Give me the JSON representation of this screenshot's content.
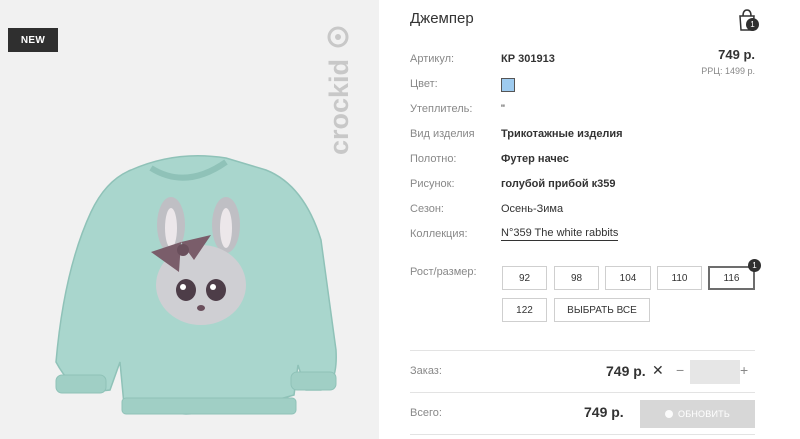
{
  "product": {
    "badge": "NEW",
    "brand": "crockid",
    "title": "Джемпер",
    "cart_count": "1",
    "colors": {
      "swatch": "#9ecbef",
      "sweater": "#a9d6cd"
    }
  },
  "details": [
    {
      "label": "Артикул:",
      "value": "КР 301913"
    },
    {
      "label": "Цвет:",
      "value": ""
    },
    {
      "label": "Утеплитель:",
      "value": "\""
    },
    {
      "label": "Вид изделия",
      "value": "Трикотажные изделия"
    },
    {
      "label": "Полотно:",
      "value": "Футер начес"
    },
    {
      "label": "Рисунок:",
      "value": "голубой прибой к359"
    },
    {
      "label": "Сезон:",
      "value": "Осень-Зима"
    },
    {
      "label": "Коллекция:",
      "value": "N°359 The white rabbits"
    }
  ],
  "pricing": {
    "price": "749 р.",
    "rrp": "РРЦ: 1499 р."
  },
  "sizes": {
    "label": "Рост/размер:",
    "options": [
      "92",
      "98",
      "104",
      "110",
      "116",
      "122"
    ],
    "selected": "116",
    "selected_count": "1",
    "select_all": "ВЫБРАТЬ ВСЕ"
  },
  "order": {
    "label": "Заказ:",
    "price": "749 р.",
    "remove": "✕",
    "minus": "−",
    "plus": "+",
    "quantity": ""
  },
  "total": {
    "label": "Всего:",
    "price": "749 р.",
    "update_button": "ОБНОВИТЬ"
  }
}
